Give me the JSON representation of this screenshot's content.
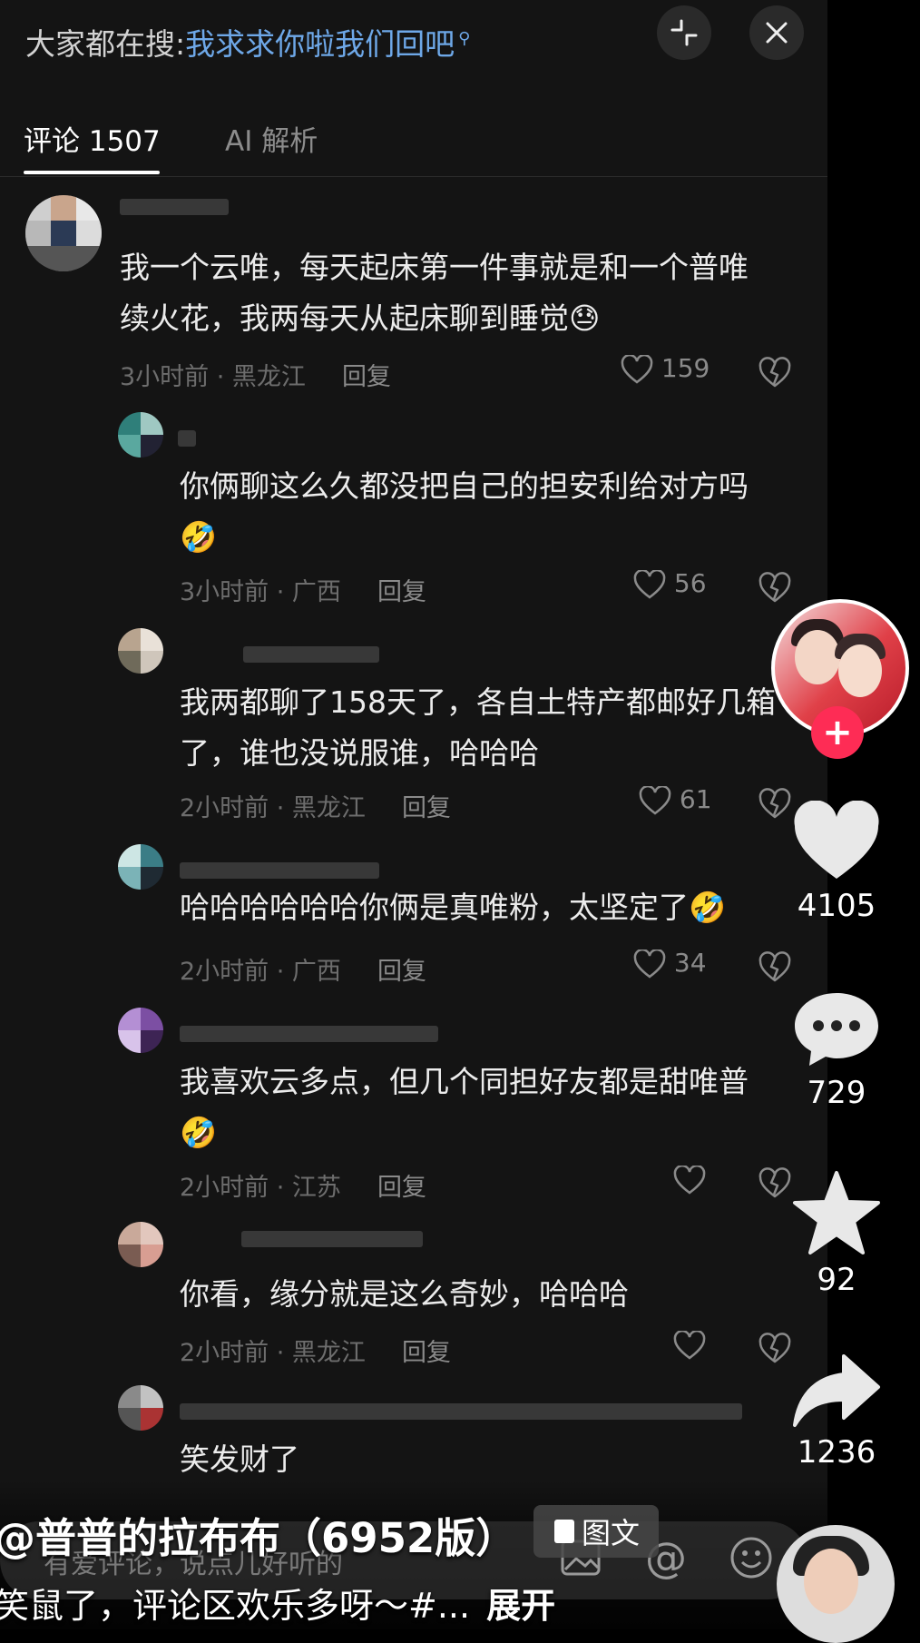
{
  "search": {
    "prefix": "大家都在搜:",
    "query": "我求求你啦我们回吧"
  },
  "tabs": {
    "comments": "评论 1507",
    "ai": "AI 解析"
  },
  "comments": [
    {
      "text": "我一个云唯，每天起床第一件事就是和一个普唯\n续火花，我两每天从起床聊到睡觉😓",
      "meta": "3小时前 · 黑龙江",
      "reply": "回复",
      "likes": "159"
    },
    {
      "text": "你俩聊这么久都没把自己的担安利给对方吗\n🤣",
      "meta": "3小时前 · 广西",
      "reply": "回复",
      "likes": "56"
    },
    {
      "text": "我两都聊了158天了，各自土特产都邮好几箱\n了，谁也没说服谁，哈哈哈",
      "meta": "2小时前 · 黑龙江",
      "reply": "回复",
      "likes": "61"
    },
    {
      "text": "哈哈哈哈哈哈你俩是真唯粉，太坚定了🤣",
      "meta": "2小时前 · 广西",
      "reply": "回复",
      "likes": "34"
    },
    {
      "text": "我喜欢云多点，但几个同担好友都是甜唯普\n🤣",
      "meta": "2小时前 · 江苏",
      "reply": "回复",
      "likes": ""
    },
    {
      "text": "你看，缘分就是这么奇妙，哈哈哈",
      "meta": "2小时前 · 黑龙江",
      "reply": "回复",
      "likes": ""
    },
    {
      "text": "笑发财了",
      "meta": "",
      "reply": "",
      "likes": ""
    }
  ],
  "rail": {
    "likes": "4105",
    "comments": "729",
    "favorites": "92",
    "shares": "1236"
  },
  "bottom": {
    "input_placeholder": "有爱评论，说点儿好听的",
    "author": "@普普的拉布布（6952版）",
    "tuwen_label": "图文",
    "caption": "笑鼠了，评论区欢乐多呀～#...",
    "expand": "展开"
  },
  "colors": {
    "accent_follow": "#fe2c55",
    "search_query": "#6ea8e8",
    "panel_bg": "#141414"
  },
  "icons": [
    "search-icon",
    "collapse-icon",
    "close-icon",
    "heart-icon",
    "dislike-icon",
    "comment-bubble-icon",
    "star-icon",
    "share-icon",
    "image-icon",
    "at-icon",
    "emoji-icon",
    "document-icon",
    "plus-icon"
  ]
}
